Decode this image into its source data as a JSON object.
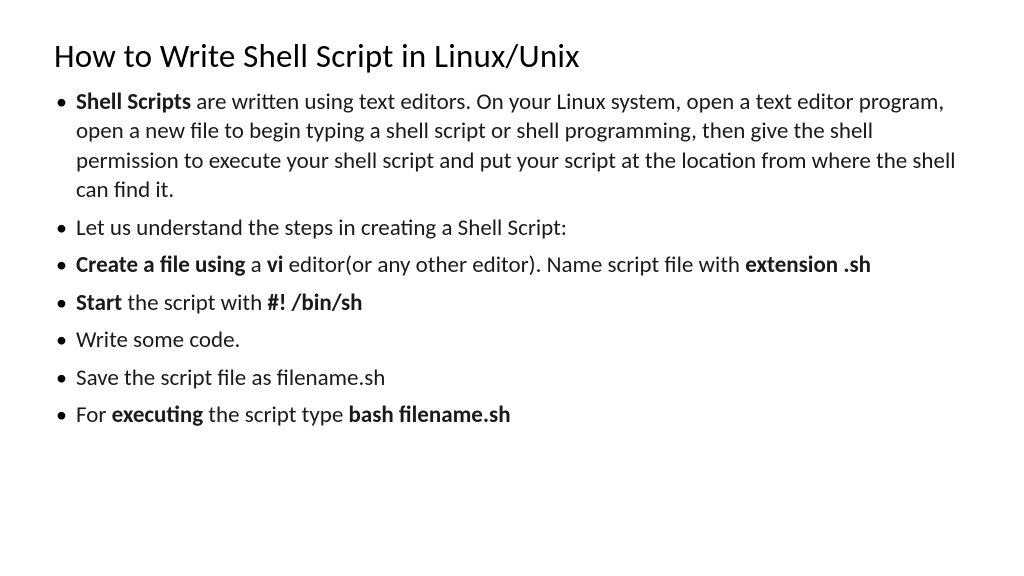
{
  "title": "How to Write Shell Script in Linux/Unix",
  "bullets": {
    "b1": {
      "bold1": "Shell Scripts",
      "rest": " are written using text editors. On your Linux system, open a text editor program, open a new file to begin typing a shell script or shell programming, then give the shell permission to execute your shell script and put your script at the location from where the shell can find it."
    },
    "b2": {
      "text": "Let us understand the steps in creating a Shell Script:"
    },
    "b3": {
      "bold1": "Create a file using",
      "mid1": " a ",
      "bold2": "vi",
      "mid2": " editor(or any other editor). Name script file with ",
      "bold3": "extension .sh"
    },
    "b4": {
      "bold1": "Start",
      "mid1": " the script with ",
      "bold2": "#! /bin/sh"
    },
    "b5": {
      "text": "Write some code."
    },
    "b6": {
      "text": "Save the script file as filename.sh"
    },
    "b7": {
      "pre": "For ",
      "bold1": "executing",
      "mid1": " the script type ",
      "bold2": "bash filename.sh"
    }
  }
}
